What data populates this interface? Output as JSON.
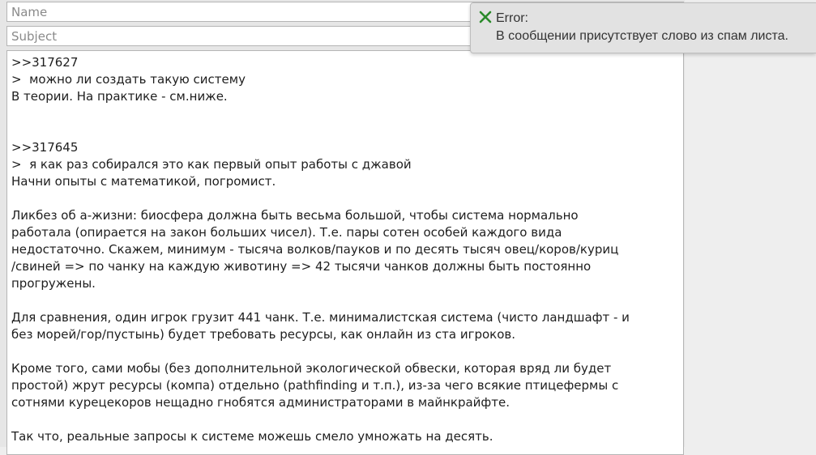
{
  "form": {
    "name_placeholder": "Name",
    "subject_placeholder": "Subject",
    "message_lines": [
      ">>317627",
      ">  можно ли создать такую систему",
      "В теории. На практике - см.ниже.",
      "",
      "",
      ">>317645",
      ">  я как раз собирался это как первый опыт работы с джавой",
      "Начни опыты с математикой, погромист.",
      "",
      "Ликбез об а-жизни: биосфера должна быть весьма большой, чтобы система нормально",
      "работала (опирается на закон больших чисел). Т.е. пары сотен особей каждого вида",
      "недостаточно. Скажем, минимум - тысяча волков/пауков и по десять тысяч овец/коров/куриц",
      "/свиней => по чанку на каждую животину => 42 тысячи чанков должны быть постоянно",
      "прогружены.",
      "",
      "Для сравнения, один игрок грузит 441 чанк. Т.е. минималистская система (чисто ландшафт - и",
      "без морей/гор/пустынь) будет требовать ресурсы, как онлайн из ста игроков.",
      "",
      "Кроме того, сами мобы (без дополнительной экологической обвески, которая вряд ли будет",
      "простой) жрут ресурсы (компа) отдельно (pathfinding и т.п.), из-за чего всякие птицефермы с",
      "сотнями курецекоров нещадно гнобятся администраторами в майнкрайфте.",
      "",
      "Так что, реальные запросы к системе можешь смело умножать на десять."
    ]
  },
  "notification": {
    "icon": "x-mark-icon",
    "icon_color": "#2a8a2a",
    "title": "Error:",
    "message": "В сообщении присутствует слово из спам листа."
  }
}
